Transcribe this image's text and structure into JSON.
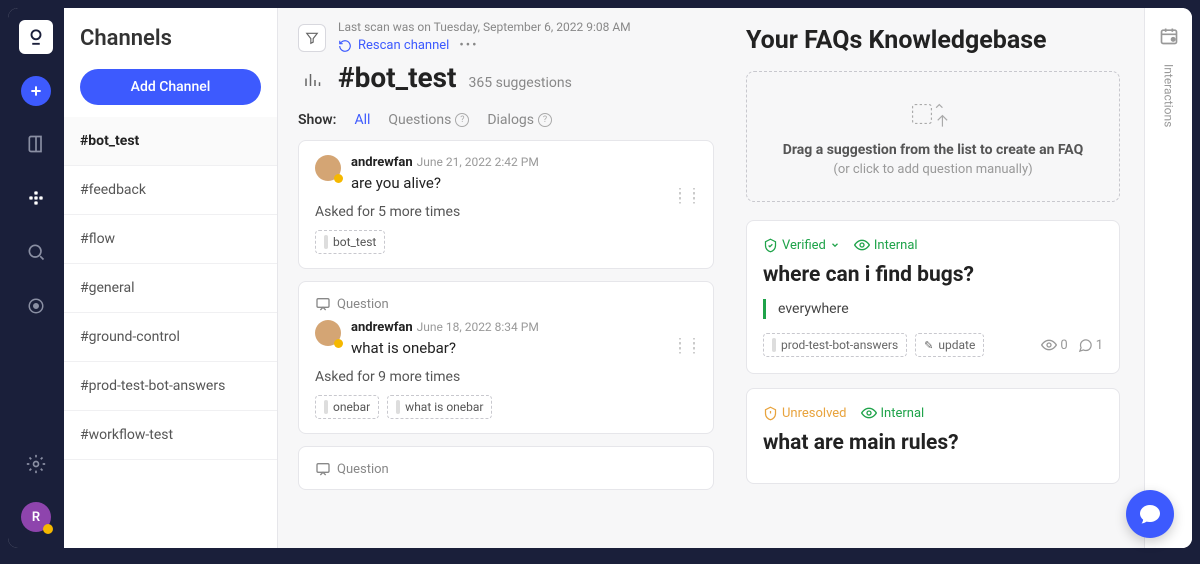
{
  "rail": {
    "avatar_initial": "R"
  },
  "sidebar": {
    "title": "Channels",
    "add_btn": "Add Channel",
    "items": [
      {
        "label": "#bot_test",
        "active": true
      },
      {
        "label": "#feedback"
      },
      {
        "label": "#flow"
      },
      {
        "label": "#general"
      },
      {
        "label": "#ground-control"
      },
      {
        "label": "#prod-test-bot-answers"
      },
      {
        "label": "#workflow-test"
      }
    ]
  },
  "header": {
    "last_scan": "Last scan was on Tuesday, September 6, 2022 9:08 AM",
    "rescan": "Rescan channel",
    "channel": "#bot_test",
    "count": "365 suggestions"
  },
  "filters": {
    "label": "Show:",
    "all": "All",
    "questions": "Questions",
    "dialogs": "Dialogs"
  },
  "suggestions": [
    {
      "type": null,
      "author": "andrewfan",
      "ts": "June 21, 2022 2:42 PM",
      "msg": "are you alive?",
      "asked": "Asked for 5 more times",
      "tags": [
        "bot_test"
      ]
    },
    {
      "type": "Question",
      "author": "andrewfan",
      "ts": "June 18, 2022 8:34 PM",
      "msg": "what is onebar?",
      "asked": "Asked for 9 more times",
      "tags": [
        "onebar",
        "what is onebar"
      ]
    },
    {
      "type": "Question",
      "author": "",
      "ts": "",
      "msg": "",
      "asked": "",
      "tags": []
    }
  ],
  "kb": {
    "title": "Your FAQs Knowledgebase",
    "dropzone": {
      "bold": "Drag a suggestion from the list to create an FAQ",
      "sub": "(or click to add question manually)"
    },
    "faqs": [
      {
        "status": "Verified",
        "internal": "Internal",
        "q": "where can i find bugs?",
        "a": "everywhere",
        "chip": "prod-test-bot-answers",
        "edit": "update",
        "views": "0",
        "comments": "1"
      },
      {
        "status": "Unresolved",
        "internal": "Internal",
        "q": "what are main rules?",
        "a": null
      }
    ]
  },
  "vr": {
    "label": "Interactions"
  }
}
